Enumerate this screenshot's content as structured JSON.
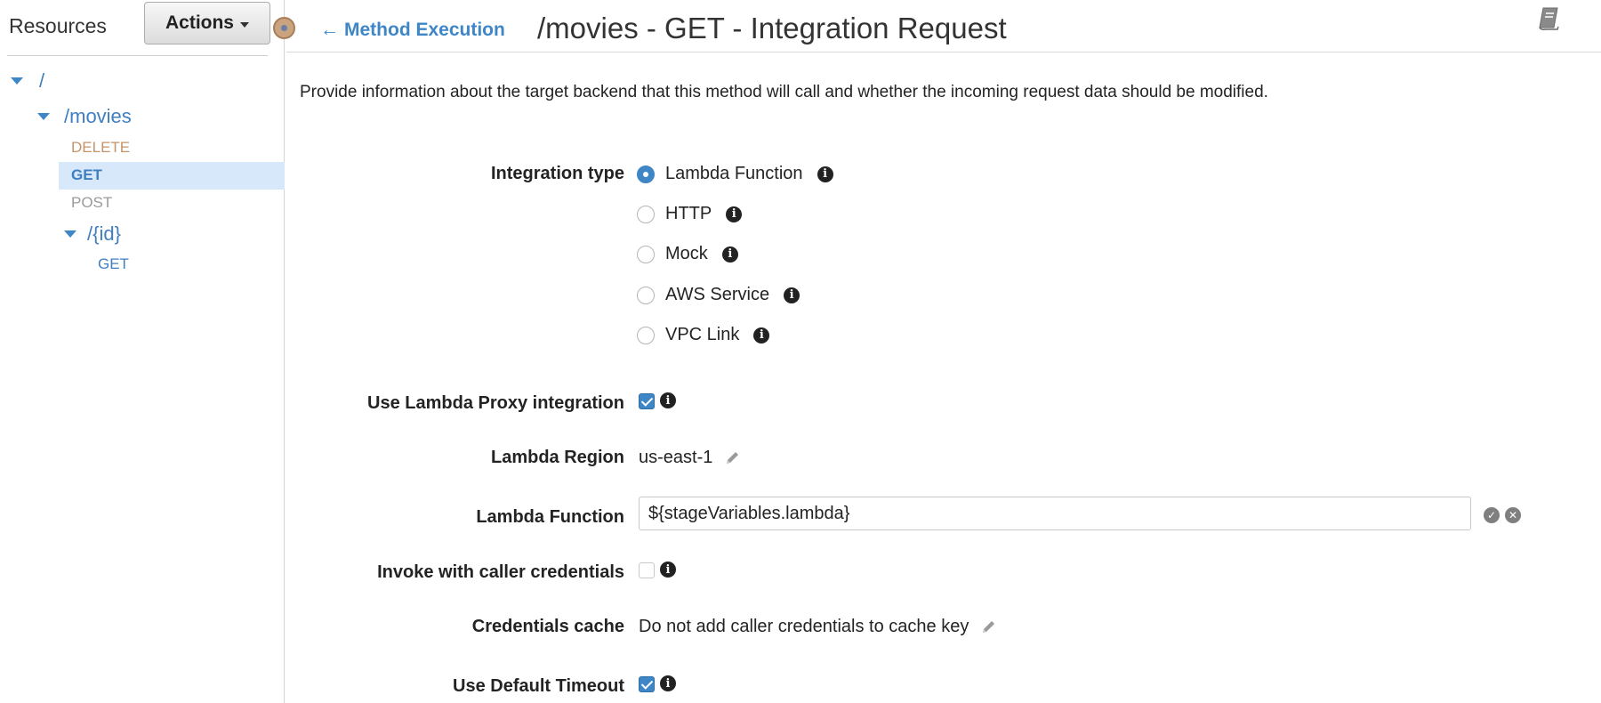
{
  "sidebar": {
    "title": "Resources",
    "actions_label": "Actions",
    "tree": {
      "root": "/",
      "movies": "/movies",
      "movies_methods": [
        "DELETE",
        "GET",
        "POST"
      ],
      "id": "/{id}",
      "id_methods": [
        "GET"
      ]
    },
    "selected": "GET"
  },
  "header": {
    "back_label": "Method Execution",
    "title": "/movies - GET - Integration Request"
  },
  "description": "Provide information about the target backend that this method will call and whether the incoming request data should be modified.",
  "form": {
    "integration_type": {
      "label": "Integration type",
      "options": [
        "Lambda Function",
        "HTTP",
        "Mock",
        "AWS Service",
        "VPC Link"
      ],
      "selected": "Lambda Function"
    },
    "lambda_proxy": {
      "label": "Use Lambda Proxy integration",
      "checked": true
    },
    "lambda_region": {
      "label": "Lambda Region",
      "value": "us-east-1"
    },
    "lambda_function": {
      "label": "Lambda Function",
      "value": "${stageVariables.lambda}"
    },
    "caller_credentials": {
      "label": "Invoke with caller credentials",
      "checked": false
    },
    "credentials_cache": {
      "label": "Credentials cache",
      "value": "Do not add caller credentials to cache key"
    },
    "default_timeout": {
      "label": "Use Default Timeout",
      "checked": true
    }
  },
  "colors": {
    "link_blue": "#3f86c6",
    "selected_row": "#d6e8fa",
    "delete_method": "#c4956a",
    "post_method": "#9a9a9a"
  }
}
